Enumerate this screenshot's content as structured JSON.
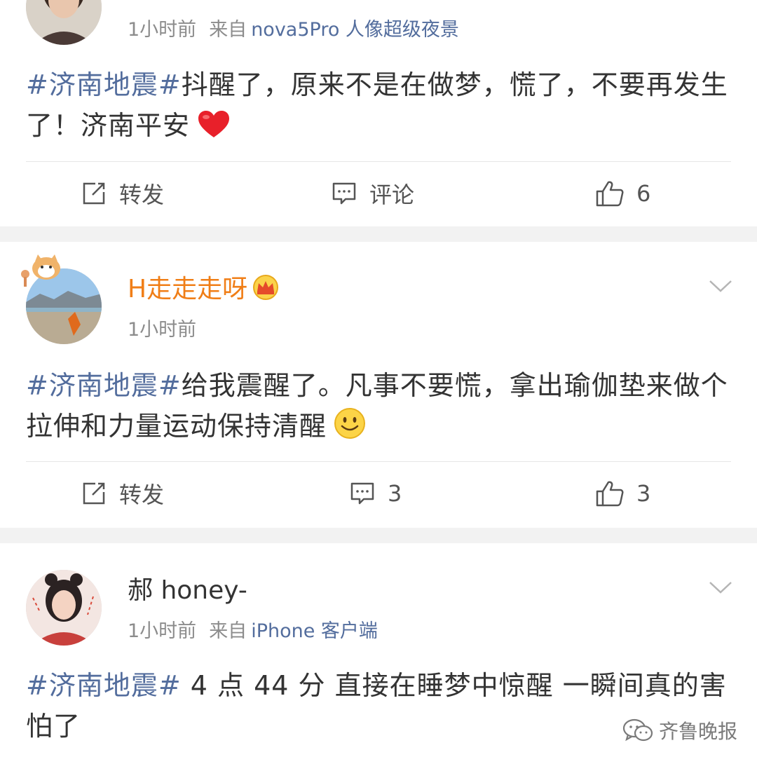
{
  "posts": [
    {
      "time": "1小时前",
      "from_prefix": "来自",
      "source": "nova5Pro 人像超级夜景",
      "topic": "#济南地震#",
      "text": "抖醒了，原来不是在做梦，慌了，不要再发生了！济南平安",
      "emoji_icon": "heart-icon",
      "actions": {
        "repost": "转发",
        "comment": "评论",
        "like": "6"
      }
    },
    {
      "name": "H走走走呀",
      "badge_icon": "crown-badge-icon",
      "time": "1小时前",
      "topic": "#济南地震#",
      "text": "给我震醒了。凡事不要慌，拿出瑜伽垫来做个拉伸和力量运动保持清醒",
      "emoji_icon": "smile-icon",
      "actions": {
        "repost": "转发",
        "comment": "3",
        "like": "3"
      }
    },
    {
      "name": "郝 honey-",
      "time": "1小时前",
      "from_prefix": "来自",
      "source": "iPhone 客户端",
      "topic": "#济南地震#",
      "text": " 4 点 44 分 直接在睡梦中惊醒 一瞬间真的害怕了"
    }
  ],
  "watermark": "齐鲁晚报",
  "colors": {
    "topic": "#536d9d",
    "name_vip": "#f07e17",
    "separator": "#f2f2f2"
  }
}
